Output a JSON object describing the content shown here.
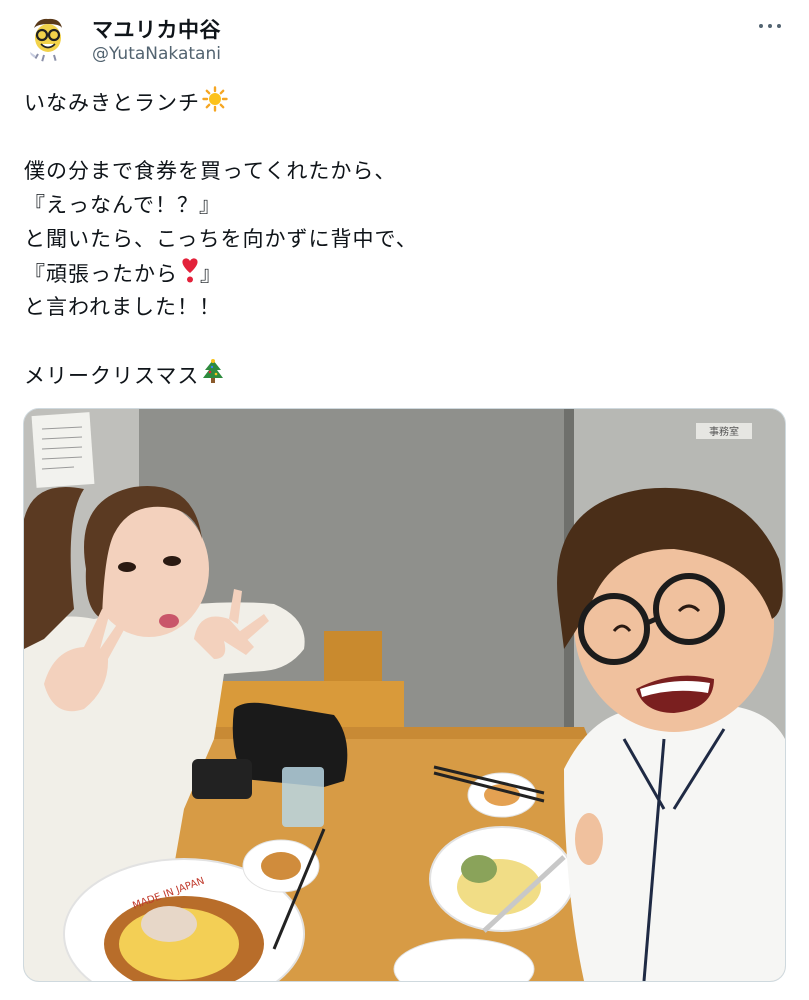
{
  "author": {
    "display_name": "マユリカ中谷",
    "handle": "@YutaNakatani",
    "avatar_icon": "cartoon-avatar-icon"
  },
  "menu": {
    "icon": "more-options-icon"
  },
  "tweet": {
    "lines": [
      "いなみきとランチ",
      "",
      "僕の分まで食券を買ってくれたから、",
      "『えっなんで！？』",
      "と聞いたら、こっちを向かずに背中で、",
      "『頑張ったから",
      "と言われました！！",
      "",
      "メリークリスマス"
    ],
    "line6_tail": "』",
    "emoji": {
      "line1": "sun-emoji",
      "line6": "heart-exclamation-emoji",
      "line9": "christmas-tree-emoji"
    }
  },
  "photo": {
    "description_icon": "lunch-photo",
    "bowl_text": "MADE IN JAPAN",
    "door_sign": "事務室"
  },
  "colors": {
    "text": "#0f1419",
    "secondary": "#536471",
    "border": "#cfd9de"
  }
}
